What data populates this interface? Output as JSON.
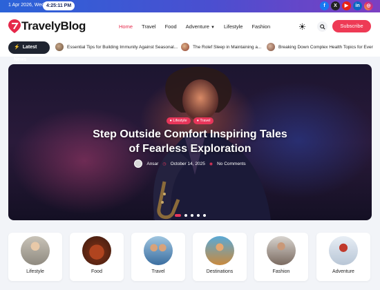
{
  "topbar": {
    "date": "1 Apr 2026, Wed",
    "time": "4:25:11 PM",
    "socials": [
      {
        "icon": "facebook-icon",
        "glyph": "f"
      },
      {
        "icon": "x-icon",
        "glyph": "X"
      },
      {
        "icon": "youtube-icon",
        "glyph": "▶"
      },
      {
        "icon": "linkedin-icon",
        "glyph": "in"
      },
      {
        "icon": "instagram-icon",
        "glyph": "◎"
      }
    ]
  },
  "header": {
    "logo": "TravelyBlog",
    "nav": [
      "Home",
      "Travel",
      "Food",
      "Adventure",
      "Lifestyle",
      "Fashion"
    ],
    "active_nav": "Home",
    "subscribe_label": "Subscribe",
    "accent": "#ee3a55"
  },
  "ticker": {
    "label": "Latest News",
    "items": [
      "Essential Tips for Building Immunity Against Seasonal...",
      "The Rolef Sleep in Maintaining a...",
      "Breaking Down Complex Health Topics for Ever"
    ]
  },
  "hero": {
    "badges": [
      "Lifestyle",
      "Travel"
    ],
    "title": "Step Outside Comfort Inspiring Tales of Fearless Exploration",
    "author": "Ansar",
    "date": "October 14, 2025",
    "comments": "No Comments",
    "slides_total": 5,
    "slide_active": 1
  },
  "categories": [
    "Lifestyle",
    "Food",
    "Travel",
    "Destinations",
    "Fashion",
    "Adventure"
  ]
}
